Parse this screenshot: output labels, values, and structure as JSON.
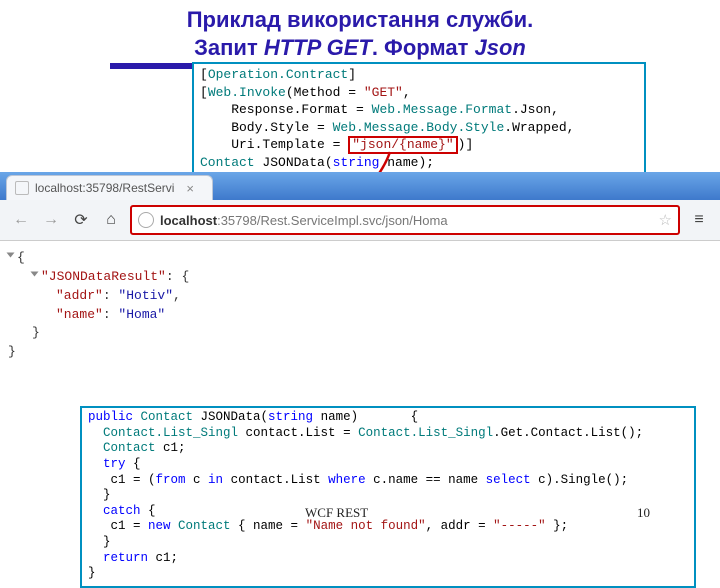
{
  "slide": {
    "title_l1": "Приклад використання служби.",
    "title_l2a": "Запит ",
    "title_l2b": "HTTP GET",
    "title_l2c": ". Формат ",
    "title_l2d": "Json"
  },
  "code_top": {
    "l1a": "[",
    "l1b": "Operation.Contract",
    "l1c": "]",
    "l2a": "[",
    "l2b": "Web.Invoke",
    "l2c": "(Method = ",
    "l2d": "\"GET\"",
    "l2e": ",",
    "l3a": "    Response.Format = ",
    "l3b": "Web.Message.Format",
    "l3c": ".Json,",
    "l4a": "    Body.Style = ",
    "l4b": "Web.Message.Body.Style",
    "l4c": ".Wrapped,",
    "l5a": "    Uri.Template = ",
    "l5b": "\"json/{name}\"",
    "l5c": ")]",
    "l6a": "Contact",
    "l6b": " JSONData(",
    "l6c": "string",
    "l6d": " name);"
  },
  "browser": {
    "tab_label": "localhost:35798/RestServi",
    "back": "←",
    "fwd": "→",
    "reload": "⟳",
    "home": "⌂",
    "url_host": "localhost",
    "url_path": ":35798/Rest.ServiceImpl.svc/json/Homa",
    "star": "☆",
    "menu": "≡"
  },
  "json_view": {
    "open": "{",
    "root_key": "\"JSONDataResult\"",
    "colon": ": ",
    "obj_open": "{",
    "addr_k": "\"addr\"",
    "addr_v": "\"Hotiv\"",
    "name_k": "\"name\"",
    "name_v": "\"Homa\"",
    "comma": ",",
    "obj_close": "}",
    "close": "}"
  },
  "code_bottom": {
    "l1a": "public ",
    "l1b": "Contact",
    "l1c": " JSONData(",
    "l1d": "string",
    "l1e": " name)       {",
    "l2a": "  ",
    "l2b": "Contact.List_Singl",
    "l2c": " contact.List = ",
    "l2d": "Contact.List_Singl",
    "l2e": ".Get.Contact.List();",
    "l3a": "  ",
    "l3b": "Contact",
    "l3c": " c1;",
    "l4a": "  ",
    "l4b": "try",
    "l4c": " {",
    "l5a": "   c1 = (",
    "l5b": "from",
    "l5c": " c ",
    "l5d": "in",
    "l5e": " contact.List ",
    "l5f": "where",
    "l5g": " c.name == name ",
    "l5h": "select",
    "l5i": " c).Single();",
    "l6": "  }",
    "l7a": "  ",
    "l7b": "catch",
    "l7c": " {",
    "l8a": "   c1 = ",
    "l8b": "new ",
    "l8c": "Contact",
    "l8d": " { name = ",
    "l8e": "\"Name not found\"",
    "l8f": ", addr = ",
    "l8g": "\"-----\"",
    "l8h": " };",
    "l9": "  }",
    "l10a": "  ",
    "l10b": "return",
    "l10c": " c1;",
    "l11": "}"
  },
  "footer": {
    "label": "WCF REST",
    "page": "10"
  }
}
